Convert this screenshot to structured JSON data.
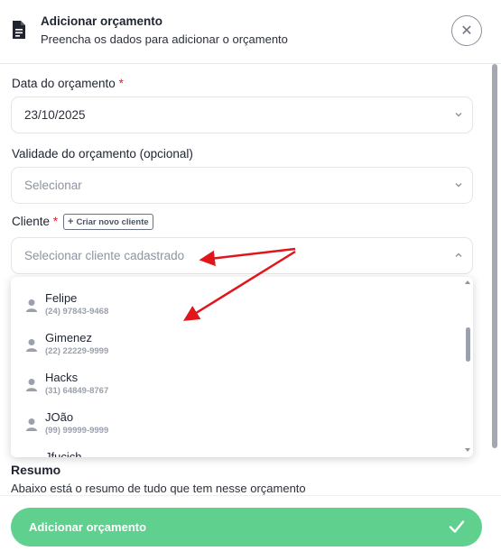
{
  "header": {
    "title": "Adicionar orçamento",
    "subtitle": "Preencha os dados para adicionar o orçamento",
    "close_icon": "close-icon",
    "doc_icon": "document-icon"
  },
  "form": {
    "date": {
      "label": "Data do orçamento",
      "required_mark": "*",
      "value": "23/10/2025"
    },
    "validity": {
      "label": "Validade do orçamento (opcional)",
      "placeholder": "Selecionar"
    },
    "client": {
      "label": "Cliente",
      "required_mark": "*",
      "create_button": "Criar novo cliente",
      "placeholder": "Selecionar cliente cadastrado",
      "options": [
        {
          "name": "Felipe",
          "phone": "(24) 97843-9468"
        },
        {
          "name": "Gimenez",
          "phone": "(22) 22229-9999"
        },
        {
          "name": "Hacks",
          "phone": "(31) 64849-8767"
        },
        {
          "name": "JOão",
          "phone": "(99) 99999-9999"
        },
        {
          "name": "Jfucich",
          "phone": ""
        }
      ]
    }
  },
  "summary": {
    "title": "Resumo",
    "subtitle": "Abaixo está o resumo de tudo que tem nesse orçamento"
  },
  "footer": {
    "submit_label": "Adicionar orçamento",
    "check_icon": "check-icon"
  },
  "colors": {
    "accent": "#5fd08e",
    "required": "#e11d2e",
    "annotation_arrow": "#e0161b"
  }
}
